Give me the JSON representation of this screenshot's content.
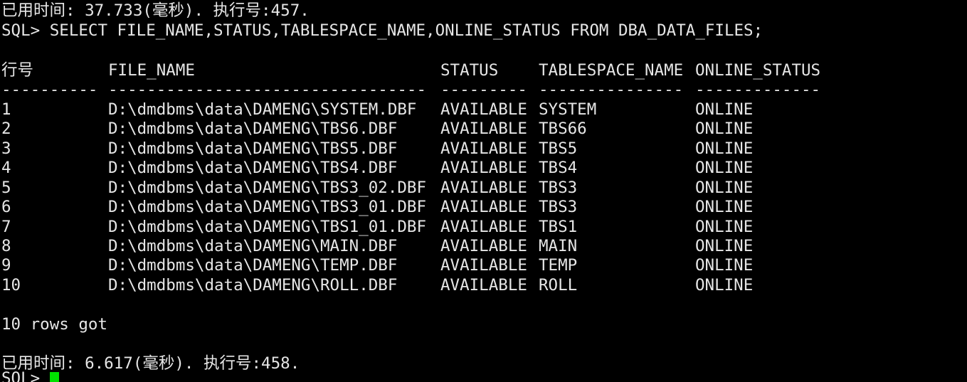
{
  "terminal": {
    "prev_elapsed": "已用时间: 37.733(毫秒). 执行号:457.",
    "command": "SQL> SELECT FILE_NAME,STATUS,TABLESPACE_NAME,ONLINE_STATUS FROM DBA_DATA_FILES;",
    "headers": [
      "行号",
      "FILE_NAME",
      "STATUS",
      "TABLESPACE_NAME",
      "ONLINE_STATUS"
    ],
    "separators": [
      "----------",
      "---------------------------------",
      "---------",
      "---------------",
      "-------------"
    ],
    "rows": [
      [
        "1",
        "D:\\dmdbms\\data\\DAMENG\\SYSTEM.DBF",
        "AVAILABLE",
        "SYSTEM",
        "ONLINE"
      ],
      [
        "2",
        "D:\\dmdbms\\data\\DAMENG\\TBS6.DBF",
        "AVAILABLE",
        "TBS66",
        "ONLINE"
      ],
      [
        "3",
        "D:\\dmdbms\\data\\DAMENG\\TBS5.DBF",
        "AVAILABLE",
        "TBS5",
        "ONLINE"
      ],
      [
        "4",
        "D:\\dmdbms\\data\\DAMENG\\TBS4.DBF",
        "AVAILABLE",
        "TBS4",
        "ONLINE"
      ],
      [
        "5",
        "D:\\dmdbms\\data\\DAMENG\\TBS3_02.DBF",
        "AVAILABLE",
        "TBS3",
        "ONLINE"
      ],
      [
        "6",
        "D:\\dmdbms\\data\\DAMENG\\TBS3_01.DBF",
        "AVAILABLE",
        "TBS3",
        "ONLINE"
      ],
      [
        "7",
        "D:\\dmdbms\\data\\DAMENG\\TBS1_01.DBF",
        "AVAILABLE",
        "TBS1",
        "ONLINE"
      ],
      [
        "8",
        "D:\\dmdbms\\data\\DAMENG\\MAIN.DBF",
        "AVAILABLE",
        "MAIN",
        "ONLINE"
      ],
      [
        "9",
        "D:\\dmdbms\\data\\DAMENG\\TEMP.DBF",
        "AVAILABLE",
        "TEMP",
        "ONLINE"
      ],
      [
        "10",
        "D:\\dmdbms\\data\\DAMENG\\ROLL.DBF",
        "AVAILABLE",
        "ROLL",
        "ONLINE"
      ]
    ],
    "rows_got": "10 rows got",
    "elapsed": "已用时间: 6.617(毫秒). 执行号:458.",
    "prompt": "SQL> ",
    "background_color": "#000000",
    "text_color": "#e6e6e6",
    "cursor_color": "#00e000"
  }
}
